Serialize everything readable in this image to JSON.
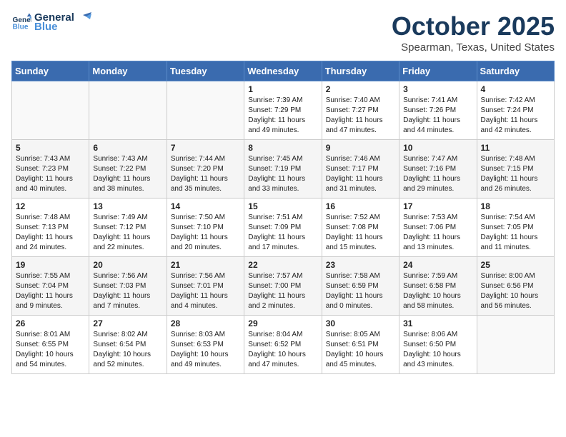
{
  "logo": {
    "line1": "General",
    "line2": "Blue"
  },
  "title": "October 2025",
  "location": "Spearman, Texas, United States",
  "days_of_week": [
    "Sunday",
    "Monday",
    "Tuesday",
    "Wednesday",
    "Thursday",
    "Friday",
    "Saturday"
  ],
  "weeks": [
    [
      {
        "day": "",
        "info": ""
      },
      {
        "day": "",
        "info": ""
      },
      {
        "day": "",
        "info": ""
      },
      {
        "day": "1",
        "info": "Sunrise: 7:39 AM\nSunset: 7:29 PM\nDaylight: 11 hours\nand 49 minutes."
      },
      {
        "day": "2",
        "info": "Sunrise: 7:40 AM\nSunset: 7:27 PM\nDaylight: 11 hours\nand 47 minutes."
      },
      {
        "day": "3",
        "info": "Sunrise: 7:41 AM\nSunset: 7:26 PM\nDaylight: 11 hours\nand 44 minutes."
      },
      {
        "day": "4",
        "info": "Sunrise: 7:42 AM\nSunset: 7:24 PM\nDaylight: 11 hours\nand 42 minutes."
      }
    ],
    [
      {
        "day": "5",
        "info": "Sunrise: 7:43 AM\nSunset: 7:23 PM\nDaylight: 11 hours\nand 40 minutes."
      },
      {
        "day": "6",
        "info": "Sunrise: 7:43 AM\nSunset: 7:22 PM\nDaylight: 11 hours\nand 38 minutes."
      },
      {
        "day": "7",
        "info": "Sunrise: 7:44 AM\nSunset: 7:20 PM\nDaylight: 11 hours\nand 35 minutes."
      },
      {
        "day": "8",
        "info": "Sunrise: 7:45 AM\nSunset: 7:19 PM\nDaylight: 11 hours\nand 33 minutes."
      },
      {
        "day": "9",
        "info": "Sunrise: 7:46 AM\nSunset: 7:17 PM\nDaylight: 11 hours\nand 31 minutes."
      },
      {
        "day": "10",
        "info": "Sunrise: 7:47 AM\nSunset: 7:16 PM\nDaylight: 11 hours\nand 29 minutes."
      },
      {
        "day": "11",
        "info": "Sunrise: 7:48 AM\nSunset: 7:15 PM\nDaylight: 11 hours\nand 26 minutes."
      }
    ],
    [
      {
        "day": "12",
        "info": "Sunrise: 7:48 AM\nSunset: 7:13 PM\nDaylight: 11 hours\nand 24 minutes."
      },
      {
        "day": "13",
        "info": "Sunrise: 7:49 AM\nSunset: 7:12 PM\nDaylight: 11 hours\nand 22 minutes."
      },
      {
        "day": "14",
        "info": "Sunrise: 7:50 AM\nSunset: 7:10 PM\nDaylight: 11 hours\nand 20 minutes."
      },
      {
        "day": "15",
        "info": "Sunrise: 7:51 AM\nSunset: 7:09 PM\nDaylight: 11 hours\nand 17 minutes."
      },
      {
        "day": "16",
        "info": "Sunrise: 7:52 AM\nSunset: 7:08 PM\nDaylight: 11 hours\nand 15 minutes."
      },
      {
        "day": "17",
        "info": "Sunrise: 7:53 AM\nSunset: 7:06 PM\nDaylight: 11 hours\nand 13 minutes."
      },
      {
        "day": "18",
        "info": "Sunrise: 7:54 AM\nSunset: 7:05 PM\nDaylight: 11 hours\nand 11 minutes."
      }
    ],
    [
      {
        "day": "19",
        "info": "Sunrise: 7:55 AM\nSunset: 7:04 PM\nDaylight: 11 hours\nand 9 minutes."
      },
      {
        "day": "20",
        "info": "Sunrise: 7:56 AM\nSunset: 7:03 PM\nDaylight: 11 hours\nand 7 minutes."
      },
      {
        "day": "21",
        "info": "Sunrise: 7:56 AM\nSunset: 7:01 PM\nDaylight: 11 hours\nand 4 minutes."
      },
      {
        "day": "22",
        "info": "Sunrise: 7:57 AM\nSunset: 7:00 PM\nDaylight: 11 hours\nand 2 minutes."
      },
      {
        "day": "23",
        "info": "Sunrise: 7:58 AM\nSunset: 6:59 PM\nDaylight: 11 hours\nand 0 minutes."
      },
      {
        "day": "24",
        "info": "Sunrise: 7:59 AM\nSunset: 6:58 PM\nDaylight: 10 hours\nand 58 minutes."
      },
      {
        "day": "25",
        "info": "Sunrise: 8:00 AM\nSunset: 6:56 PM\nDaylight: 10 hours\nand 56 minutes."
      }
    ],
    [
      {
        "day": "26",
        "info": "Sunrise: 8:01 AM\nSunset: 6:55 PM\nDaylight: 10 hours\nand 54 minutes."
      },
      {
        "day": "27",
        "info": "Sunrise: 8:02 AM\nSunset: 6:54 PM\nDaylight: 10 hours\nand 52 minutes."
      },
      {
        "day": "28",
        "info": "Sunrise: 8:03 AM\nSunset: 6:53 PM\nDaylight: 10 hours\nand 49 minutes."
      },
      {
        "day": "29",
        "info": "Sunrise: 8:04 AM\nSunset: 6:52 PM\nDaylight: 10 hours\nand 47 minutes."
      },
      {
        "day": "30",
        "info": "Sunrise: 8:05 AM\nSunset: 6:51 PM\nDaylight: 10 hours\nand 45 minutes."
      },
      {
        "day": "31",
        "info": "Sunrise: 8:06 AM\nSunset: 6:50 PM\nDaylight: 10 hours\nand 43 minutes."
      },
      {
        "day": "",
        "info": ""
      }
    ]
  ]
}
